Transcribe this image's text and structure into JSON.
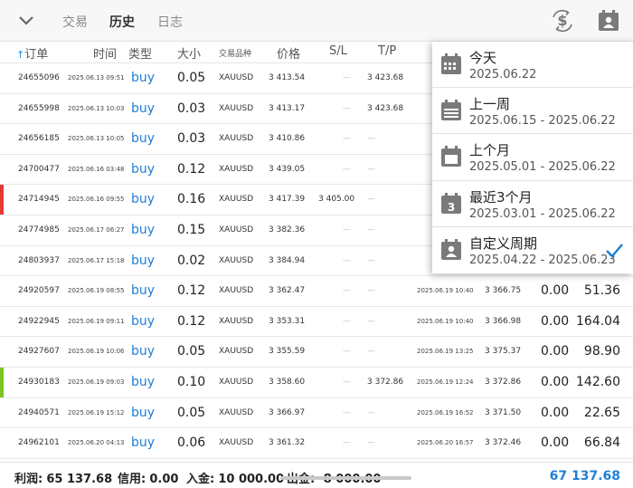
{
  "toolbar": {
    "tabs": [
      {
        "label": "交易",
        "active": false
      },
      {
        "label": "历史",
        "active": true
      },
      {
        "label": "日志",
        "active": false
      }
    ],
    "icons": [
      "chevron-down-icon",
      "currency-exchange-icon",
      "calendar-user-icon"
    ]
  },
  "columns": {
    "order": "订单",
    "time": "时间",
    "type": "类型",
    "volume": "大小",
    "symbol": "交易品种",
    "price": "价格",
    "sl": "S/L",
    "tp": "T/P"
  },
  "rows": [
    {
      "id": "24655096",
      "time": "2025.06.13 09:51",
      "type": "buy",
      "volume": "0.05",
      "symbol": "XAUUSD",
      "price": "3 413.54",
      "sl": "—",
      "tp": "3 423.68",
      "close_time": "",
      "close_price": "",
      "fee": "",
      "profit": "",
      "marker": ""
    },
    {
      "id": "24655998",
      "time": "2025.06.13 10:03",
      "type": "buy",
      "volume": "0.03",
      "symbol": "XAUUSD",
      "price": "3 413.17",
      "sl": "—",
      "tp": "3 423.68",
      "close_time": "",
      "close_price": "",
      "fee": "",
      "profit": "",
      "marker": ""
    },
    {
      "id": "24656185",
      "time": "2025.06.13 10:05",
      "type": "buy",
      "volume": "0.03",
      "symbol": "XAUUSD",
      "price": "3 410.86",
      "sl": "—",
      "tp": "—",
      "close_time": "",
      "close_price": "",
      "fee": "",
      "profit": "",
      "marker": ""
    },
    {
      "id": "24700477",
      "time": "2025.06.16 03:48",
      "type": "buy",
      "volume": "0.12",
      "symbol": "XAUUSD",
      "price": "3 439.05",
      "sl": "—",
      "tp": "—",
      "close_time": "",
      "close_price": "",
      "fee": "",
      "profit": "",
      "marker": ""
    },
    {
      "id": "24714945",
      "time": "2025.06.16 09:55",
      "type": "buy",
      "volume": "0.16",
      "symbol": "XAUUSD",
      "price": "3 417.39",
      "sl": "3 405.00",
      "tp": "—",
      "close_time": "",
      "close_price": "",
      "fee": "",
      "profit": "",
      "marker": "#e53935"
    },
    {
      "id": "24774985",
      "time": "2025.06.17 06:27",
      "type": "buy",
      "volume": "0.15",
      "symbol": "XAUUSD",
      "price": "3 382.36",
      "sl": "—",
      "tp": "—",
      "close_time": "",
      "close_price": "",
      "fee": "",
      "profit": "",
      "marker": ""
    },
    {
      "id": "24803937",
      "time": "2025.06.17 15:18",
      "type": "buy",
      "volume": "0.02",
      "symbol": "XAUUSD",
      "price": "3 384.94",
      "sl": "—",
      "tp": "—",
      "close_time": "",
      "close_price": "",
      "fee": "",
      "profit": "",
      "marker": ""
    },
    {
      "id": "24920597",
      "time": "2025.06.19 08:55",
      "type": "buy",
      "volume": "0.12",
      "symbol": "XAUUSD",
      "price": "3 362.47",
      "sl": "—",
      "tp": "—",
      "close_time": "2025.06.19 10:40",
      "close_price": "3 366.75",
      "fee": "0.00",
      "profit": "51.36",
      "marker": ""
    },
    {
      "id": "24922945",
      "time": "2025.06.19 09:11",
      "type": "buy",
      "volume": "0.12",
      "symbol": "XAUUSD",
      "price": "3 353.31",
      "sl": "—",
      "tp": "—",
      "close_time": "2025.06.19 10:40",
      "close_price": "3 366.98",
      "fee": "0.00",
      "profit": "164.04",
      "marker": ""
    },
    {
      "id": "24927607",
      "time": "2025.06.19 10:06",
      "type": "buy",
      "volume": "0.05",
      "symbol": "XAUUSD",
      "price": "3 355.59",
      "sl": "—",
      "tp": "—",
      "close_time": "2025.06.19 13:25",
      "close_price": "3 375.37",
      "fee": "0.00",
      "profit": "98.90",
      "marker": ""
    },
    {
      "id": "24930183",
      "time": "2025.06.19 09:03",
      "type": "buy",
      "volume": "0.10",
      "symbol": "XAUUSD",
      "price": "3 358.60",
      "sl": "—",
      "tp": "3 372.86",
      "close_time": "2025.06.19 12:24",
      "close_price": "3 372.86",
      "fee": "0.00",
      "profit": "142.60",
      "marker": "#7cc520"
    },
    {
      "id": "24940571",
      "time": "2025.06.19 15:12",
      "type": "buy",
      "volume": "0.05",
      "symbol": "XAUUSD",
      "price": "3 366.97",
      "sl": "—",
      "tp": "—",
      "close_time": "2025.06.19 16:52",
      "close_price": "3 371.50",
      "fee": "0.00",
      "profit": "22.65",
      "marker": ""
    },
    {
      "id": "24962101",
      "time": "2025.06.20 04:13",
      "type": "buy",
      "volume": "0.06",
      "symbol": "XAUUSD",
      "price": "3 361.32",
      "sl": "—",
      "tp": "—",
      "close_time": "2025.06.20 16:57",
      "close_price": "3 372.46",
      "fee": "0.00",
      "profit": "66.84",
      "marker": ""
    }
  ],
  "dropdown": {
    "options": [
      {
        "title": "今天",
        "range": "2025.06.22",
        "icon": "calendar-icon",
        "selected": false
      },
      {
        "title": "上一周",
        "range": "2025.06.15 - 2025.06.22",
        "icon": "calendar-week-icon",
        "selected": false
      },
      {
        "title": "上个月",
        "range": "2025.05.01 - 2025.06.22",
        "icon": "calendar-month-icon",
        "selected": false
      },
      {
        "title": "最近3个月",
        "range": "2025.03.01 - 2025.06.22",
        "icon": "calendar-3-icon",
        "selected": false
      },
      {
        "title": "自定义周期",
        "range": "2025.04.22 - 2025.06.23",
        "icon": "calendar-user-icon",
        "selected": true
      }
    ]
  },
  "footer": {
    "profit_label": "利润:",
    "profit": "65 137.68",
    "credit_label": "信用:",
    "credit": "0.00",
    "deposit_label": "入金:",
    "deposit": "10 000.00",
    "withdrawal_label": "出金:",
    "withdrawal": "-8 000.00",
    "total": "67 137.68"
  },
  "colors": {
    "accent": "#1e7fd6",
    "loss_marker": "#e53935",
    "profit_marker": "#7cc520"
  }
}
